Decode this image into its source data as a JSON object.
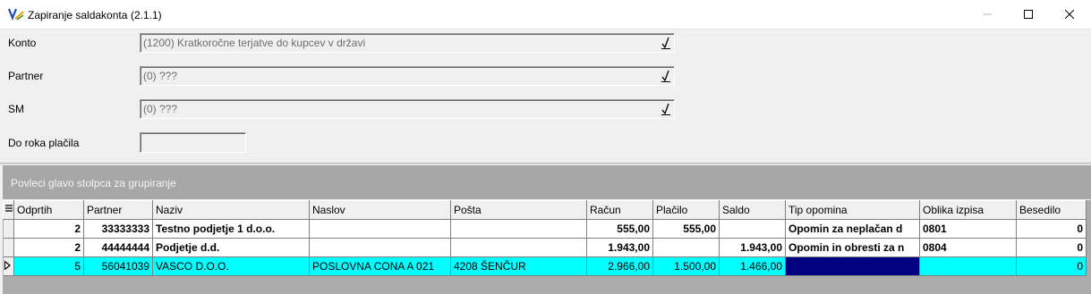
{
  "window": {
    "title": "Zapiranje saldakonta",
    "version": "(2.1.1)"
  },
  "form": {
    "konto_label": "Konto",
    "konto_value": "(1200) Kratkoročne terjatve do kupcev v državi",
    "partner_label": "Partner",
    "partner_value": "(0) ???",
    "sm_label": "SM",
    "sm_value": "(0) ???",
    "rok_label": "Do roka plačila",
    "rok_value": ""
  },
  "grid": {
    "group_hint": "Povleci glavo stolpca za grupiranje",
    "columns": [
      "Odprtih",
      "Partner",
      "Naziv",
      "Naslov",
      "Pošta",
      "Račun",
      "Plačilo",
      "Saldo",
      "Tip opomina",
      "Oblika izpisa",
      "Besedilo"
    ],
    "rows": [
      [
        "2",
        "33333333",
        "Testno podjetje 1 d.o.o.",
        "",
        "",
        "555,00",
        "555,00",
        "",
        "Opomin za neplačan d",
        "0801",
        "0"
      ],
      [
        "2",
        "44444444",
        "Podjetje d.d.",
        "",
        "",
        "1.943,00",
        "",
        "1.943,00",
        "Opomin in obresti za n",
        "0804",
        "0"
      ],
      [
        "5",
        "56041039",
        "VASCO D.O.O.",
        "POSLOVNA CONA A 021",
        "4208 ŠENČUR",
        "2.966,00",
        "1.500,00",
        "1.466,00",
        "",
        "",
        "0"
      ]
    ]
  },
  "colors": {
    "selected_row": "#00ffff",
    "selected_cell": "#000080",
    "group_panel": "#a7a7a7"
  },
  "icons": {
    "app": "vasco-logo-icon",
    "dropdown": "checkmark-dropdown-icon"
  }
}
